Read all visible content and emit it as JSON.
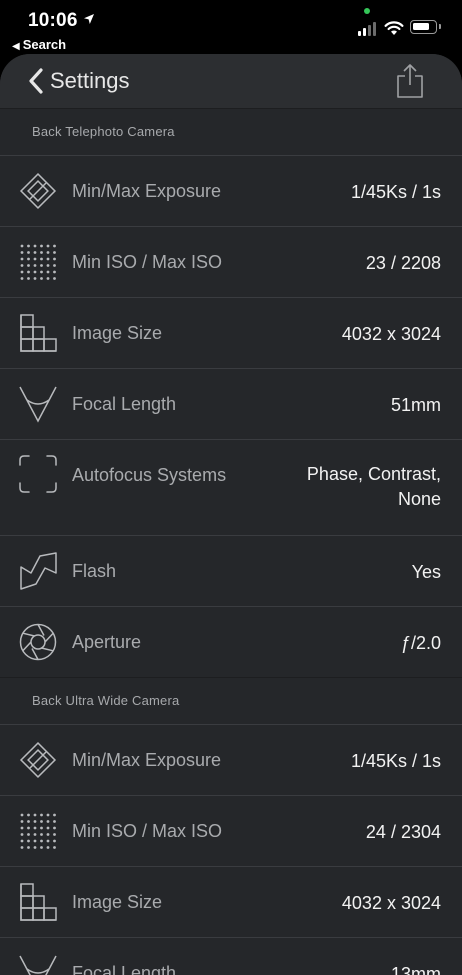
{
  "status_bar": {
    "time": "10:06",
    "back_app_label": "Search"
  },
  "nav": {
    "back_label": "Settings",
    "share_icon": "share-icon"
  },
  "sections": [
    {
      "title": "Back Telephoto Camera",
      "rows": [
        {
          "icon": "exposure-icon",
          "label": "Min/Max Exposure",
          "value": "1/45Ks / 1s"
        },
        {
          "icon": "iso-icon",
          "label": "Min ISO / Max ISO",
          "value": "23 / 2208"
        },
        {
          "icon": "image-size-icon",
          "label": "Image Size",
          "value": "4032 x 3024"
        },
        {
          "icon": "focal-length-icon",
          "label": "Focal Length",
          "value": "51mm"
        },
        {
          "icon": "autofocus-icon",
          "label": "Autofocus Systems",
          "value_line1": "Phase, Contrast,",
          "value_line2": "None"
        },
        {
          "icon": "flash-icon",
          "label": "Flash",
          "value": "Yes"
        },
        {
          "icon": "aperture-icon",
          "label": "Aperture",
          "value": "ƒ/2.0"
        }
      ]
    },
    {
      "title": "Back Ultra Wide Camera",
      "rows": [
        {
          "icon": "exposure-icon",
          "label": "Min/Max Exposure",
          "value": "1/45Ks / 1s"
        },
        {
          "icon": "iso-icon",
          "label": "Min ISO / Max ISO",
          "value": "24 / 2304"
        },
        {
          "icon": "image-size-icon",
          "label": "Image Size",
          "value": "4032 x 3024"
        },
        {
          "icon": "focal-length-icon",
          "label": "Focal Length",
          "value": "13mm"
        }
      ]
    }
  ],
  "colors": {
    "background": "#2c2e31",
    "list_background": "#25272a",
    "label": "#a9abae",
    "value": "#f2f2f2",
    "icon": "#b8babd"
  }
}
